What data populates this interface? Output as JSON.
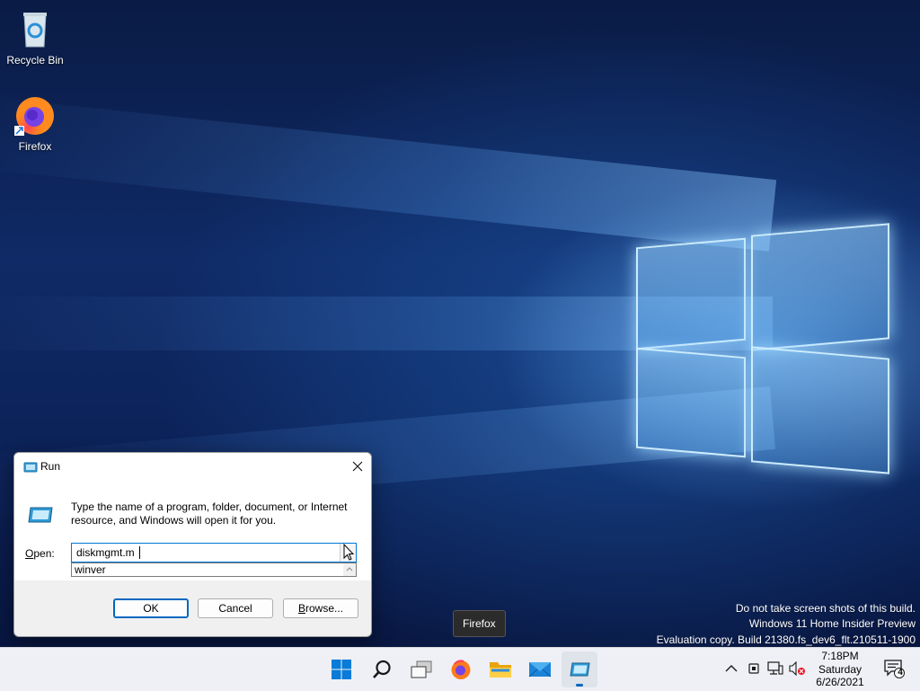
{
  "desktop": {
    "icons": [
      {
        "label": "Recycle Bin"
      },
      {
        "label": "Firefox"
      }
    ],
    "watermark": {
      "line1": "Do not take screen shots of this build.",
      "line2": "Windows 11 Home Insider Preview",
      "line3": "Evaluation copy. Build 21380.fs_dev6_flt.210511-1900"
    },
    "tooltip": "Firefox"
  },
  "run_dialog": {
    "title": "Run",
    "description": "Type the name of a program, folder, document, or Internet resource, and Windows will open it for you.",
    "open_label_underlined": "O",
    "open_label_rest": "pen:",
    "open_value": "diskmgmt.m",
    "autocomplete_items": [
      "winver"
    ],
    "buttons": {
      "ok": "OK",
      "cancel": "Cancel",
      "browse_underlined": "B",
      "browse_rest": "rowse..."
    }
  },
  "taskbar": {
    "apps": [
      {
        "icon": "start-icon"
      },
      {
        "icon": "search-icon"
      },
      {
        "icon": "task-view-icon"
      },
      {
        "icon": "firefox-icon"
      },
      {
        "icon": "file-explorer-icon"
      },
      {
        "icon": "mail-icon"
      },
      {
        "icon": "run-icon",
        "active": true
      }
    ],
    "clock": {
      "time": "7:18PM",
      "day": "Saturday",
      "date": "6/26/2021"
    },
    "notification_count": "4"
  },
  "colors": {
    "accent": "#0067c0",
    "taskbar_bg": "#eef0f5"
  }
}
